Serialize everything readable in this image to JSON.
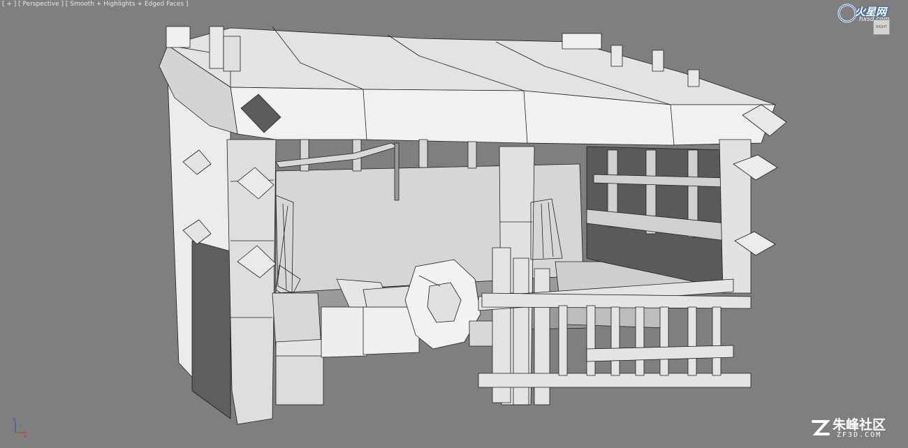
{
  "viewport": {
    "label_parts": [
      "[ + ]",
      "[ Perspective ]",
      "[ Smooth + Highlights + Edged Faces ]"
    ],
    "background": "#7f7f7f",
    "shade_color": "#dcdcdc",
    "edge_color": "#1e1e1e"
  },
  "logo": {
    "brand": "火星网",
    "domain": "hxsd.com"
  },
  "viewcube": {
    "label": "RIGHT"
  },
  "axis_tripod": {
    "x": "x",
    "y": "y",
    "z": "z"
  },
  "watermark": {
    "cn": "朱峰社区",
    "en": "ZF3D.COM"
  }
}
